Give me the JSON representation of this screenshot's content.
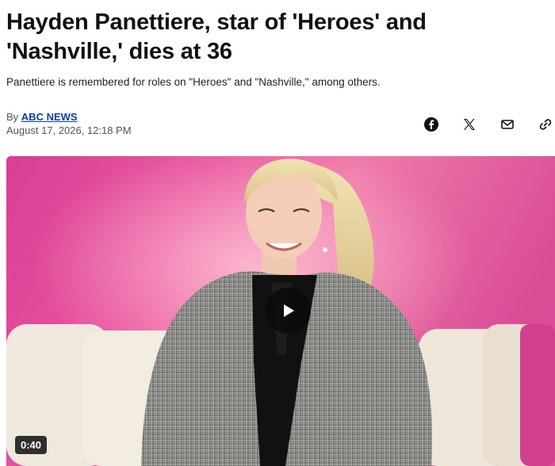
{
  "article": {
    "headline": "Hayden Panettiere, star of 'Heroes' and 'Nashville,' dies at 36",
    "subheadline": "Panettiere is remembered for roles on \"Heroes\" and \"Nashville,\" among others.",
    "byline_prefix": "By",
    "author": "ABC NEWS",
    "date": "August 17, 2026, 12:18 PM"
  },
  "share": {
    "icons": [
      "facebook-icon",
      "x-icon",
      "email-icon",
      "link-icon"
    ]
  },
  "video": {
    "duration": "0:40",
    "play_icon": "play-icon"
  },
  "colors": {
    "author_link": "#0a3fa8",
    "background_pink": "#e04a9a"
  }
}
